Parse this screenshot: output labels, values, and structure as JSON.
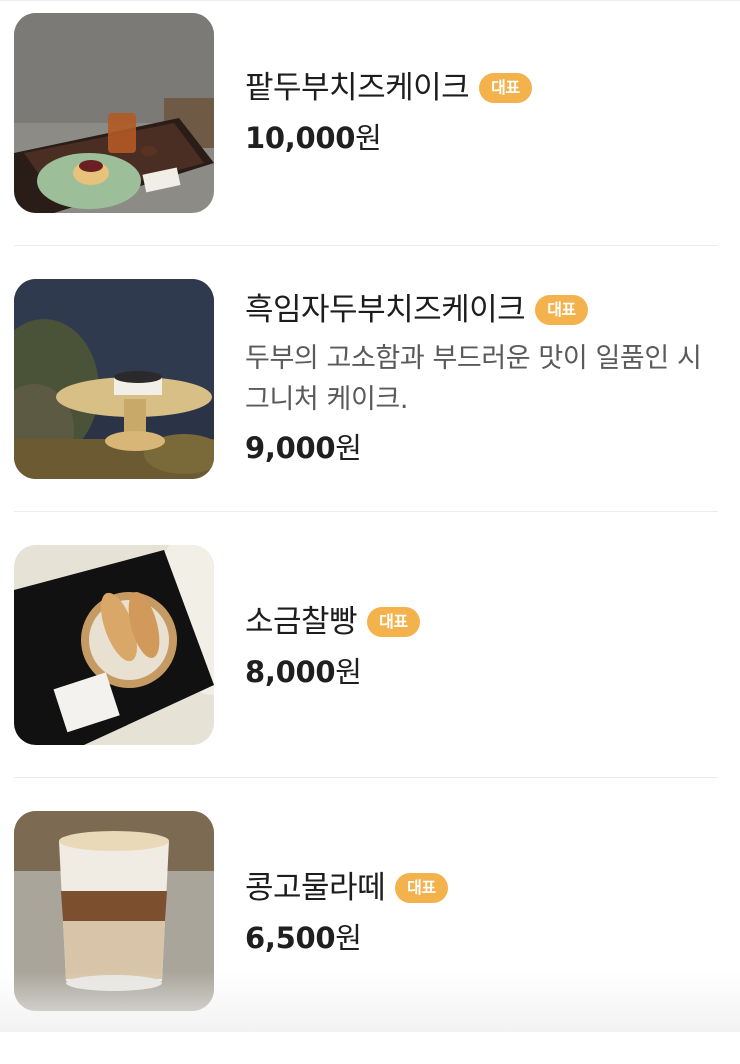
{
  "menu": {
    "items": [
      {
        "name": "팥두부치즈케이크",
        "badge": "대표",
        "description": "",
        "price_number": "10,000",
        "price_unit": "원",
        "photo": "red-bean-tofu-cheesecake-photo"
      },
      {
        "name": "흑임자두부치즈케이크",
        "badge": "대표",
        "description": "두부의 고소함과 부드러운 맛이 일품인 시그니처 케이크.",
        "price_number": "9,000",
        "price_unit": "원",
        "photo": "black-sesame-tofu-cheesecake-photo"
      },
      {
        "name": "소금찰빵",
        "badge": "대표",
        "description": "",
        "price_number": "8,000",
        "price_unit": "원",
        "photo": "salt-bread-photo"
      },
      {
        "name": "콩고물라떼",
        "badge": "대표",
        "description": "",
        "price_number": "6,500",
        "price_unit": "원",
        "photo": "soybean-powder-latte-photo"
      }
    ]
  },
  "colors": {
    "badge": "#f3b24c",
    "divider": "#ececec",
    "description": "#5a5a5a"
  }
}
